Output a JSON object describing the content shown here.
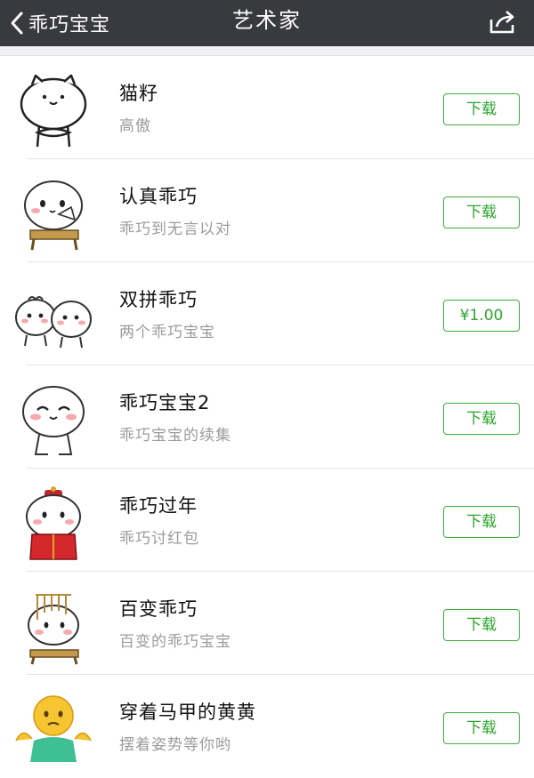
{
  "header": {
    "back_label": "乖巧宝宝",
    "title": "艺术家",
    "back_icon": "chevron-left-icon",
    "share_icon": "share-icon"
  },
  "colors": {
    "navbar": "#393a3f",
    "accent": "#3cb03c"
  },
  "items": [
    {
      "name": "猫籽",
      "desc": "高傲",
      "button": "下载",
      "icon": "cat-sticker-icon"
    },
    {
      "name": "认真乖巧",
      "desc": "乖巧到无言以对",
      "button": "下载",
      "icon": "fan-bun-sticker-icon"
    },
    {
      "name": "双拼乖巧",
      "desc": "两个乖巧宝宝",
      "button": "¥1.00",
      "icon": "twin-bun-sticker-icon"
    },
    {
      "name": "乖巧宝宝2",
      "desc": "乖巧宝宝的续集",
      "button": "下载",
      "icon": "happy-bun-sticker-icon"
    },
    {
      "name": "乖巧过年",
      "desc": "乖巧讨红包",
      "button": "下载",
      "icon": "new-year-bun-sticker-icon"
    },
    {
      "name": "百变乖巧",
      "desc": "百变的乖巧宝宝",
      "button": "下载",
      "icon": "cage-bun-sticker-icon"
    },
    {
      "name": "穿着马甲的黄黄",
      "desc": "摆着姿势等你哟",
      "button": "下载",
      "icon": "yellow-emoji-sticker-icon"
    }
  ]
}
